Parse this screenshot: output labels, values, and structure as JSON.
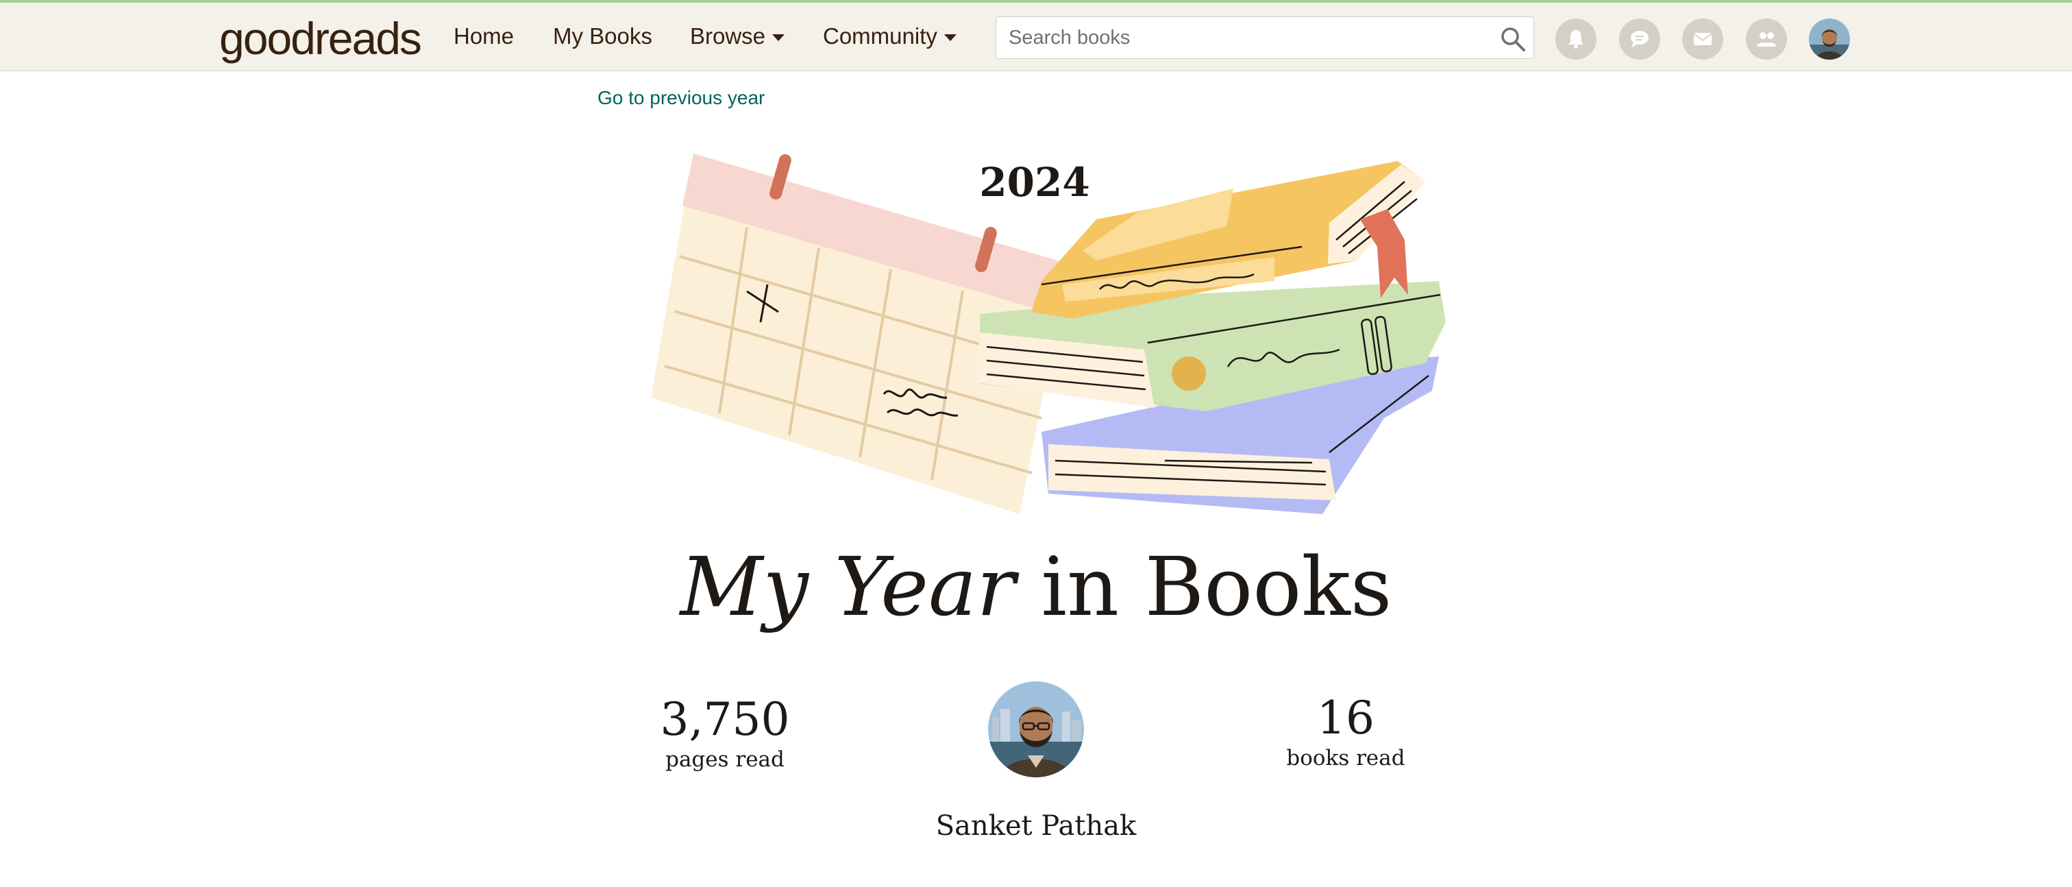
{
  "header": {
    "logo": {
      "good": "good",
      "reads": "reads"
    },
    "nav": {
      "home": "Home",
      "my_books": "My Books",
      "browse": "Browse",
      "community": "Community"
    },
    "search": {
      "placeholder": "Search books",
      "icon": "search-icon"
    },
    "icons": [
      "bell-icon",
      "chat-icon",
      "mail-icon",
      "friends-icon"
    ],
    "colors": {
      "bar": "#f4f1ea",
      "accent_line": "#a5d294",
      "text": "#382110",
      "icon_bg": "#d6d0c4"
    }
  },
  "main": {
    "prev_link": "Go to previous year",
    "year": "2024",
    "title": {
      "part1": "My",
      "part2": "Year",
      "part3": "in Books"
    },
    "stats": {
      "pages": {
        "value": "3,750",
        "label": "pages read"
      },
      "books": {
        "value": "16",
        "label": "books read"
      }
    },
    "user_name": "Sanket Pathak",
    "colors": {
      "link": "#00635d",
      "ink": "#1e1915"
    }
  }
}
